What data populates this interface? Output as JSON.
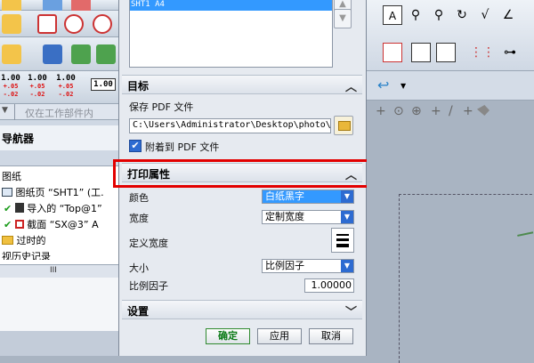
{
  "left_panel": {
    "tolerances": [
      {
        "value": "1.00",
        "plus": "+.05",
        "minus": "-.02"
      },
      {
        "value": "1.00",
        "plus": "+.05",
        "minus": "-.02"
      },
      {
        "value": "1.00",
        "plus": "+.05",
        "minus": "-.02"
      },
      {
        "value": "1.00",
        "plus": "",
        "minus": ""
      }
    ],
    "filter_text": "仅在工作部件内",
    "navigator_title": "导航器",
    "tree": [
      {
        "label": "图纸"
      },
      {
        "label": "图纸页 “SHT1” (工."
      },
      {
        "label": "导入的 “Top@1”"
      },
      {
        "label": "截面 “SX@3” A"
      },
      {
        "label": "过时的"
      },
      {
        "label": "视历史记录"
      }
    ],
    "scroll_label": "III"
  },
  "dialog": {
    "sheet_item": "SHT1  A4",
    "section_target": "目标",
    "save_pdf_label": "保存 PDF 文件",
    "path_value": "C:\\Users\\Administrator\\Desktop\\photo\\#",
    "attach_label": "附着到 PDF 文件",
    "attach_checked": true,
    "section_print": "打印属性",
    "color_label": "颜色",
    "color_value": "白纸黑字",
    "width_label": "宽度",
    "width_value": "定制宽度",
    "custom_width_label": "定义宽度",
    "size_label": "大小",
    "size_value": "比例因子",
    "scale_label": "比例因子",
    "scale_value": "1.00000",
    "section_settings": "设置",
    "ok": "确定",
    "apply": "应用",
    "cancel": "取消"
  },
  "colors": {
    "accent": "#3399ff",
    "highlight": "#e30000",
    "ok_text": "#0a7a16"
  }
}
